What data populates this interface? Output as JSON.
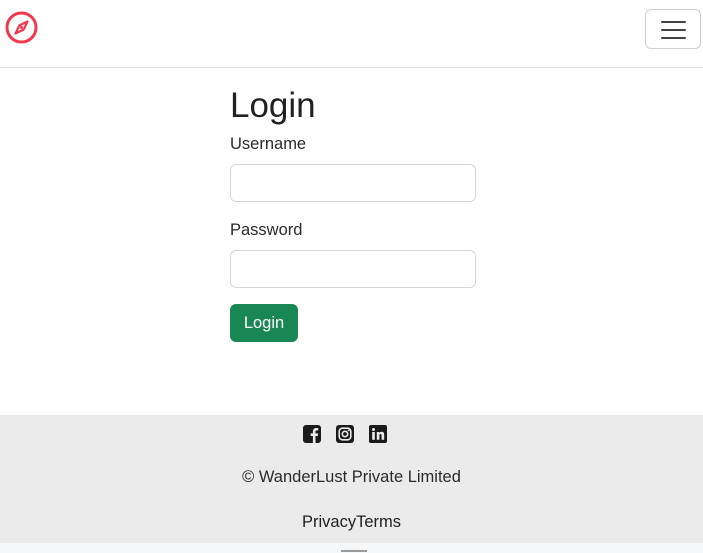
{
  "navbar": {
    "brand_icon": "compass-icon",
    "brand_color": "#f0394f",
    "toggler_icon": "hamburger-menu-icon"
  },
  "login": {
    "title": "Login",
    "username_label": "Username",
    "username_value": "",
    "password_label": "Password",
    "password_value": "",
    "submit_label": "Login",
    "submit_color": "#198754"
  },
  "footer": {
    "social_icons": [
      "facebook-icon",
      "instagram-icon",
      "linkedin-icon"
    ],
    "copyright": "© WanderLust Private Limited",
    "links": [
      "Privacy",
      "Terms"
    ]
  }
}
